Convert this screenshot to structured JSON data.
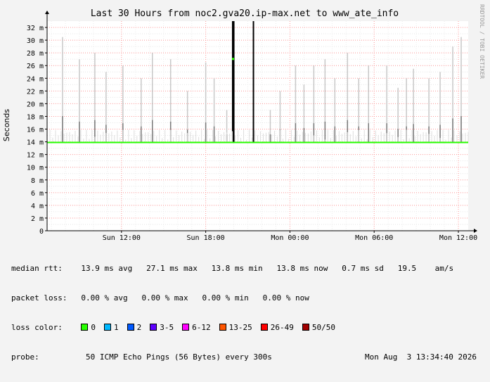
{
  "chart_data": {
    "type": "line",
    "title": "Last 30 Hours from noc2.gva20.ip-max.net to www_ate_info",
    "ylabel": "Seconds",
    "watermark": "RRDTOOL / TOBI OETIKER",
    "ylim": [
      0,
      33
    ],
    "y_ticks": [
      {
        "v": 0,
        "label": "0"
      },
      {
        "v": 2,
        "label": "2 m"
      },
      {
        "v": 4,
        "label": "4 m"
      },
      {
        "v": 6,
        "label": "6 m"
      },
      {
        "v": 8,
        "label": "8 m"
      },
      {
        "v": 10,
        "label": "10 m"
      },
      {
        "v": 12,
        "label": "12 m"
      },
      {
        "v": 14,
        "label": "14 m"
      },
      {
        "v": 16,
        "label": "16 m"
      },
      {
        "v": 18,
        "label": "18 m"
      },
      {
        "v": 20,
        "label": "20 m"
      },
      {
        "v": 22,
        "label": "22 m"
      },
      {
        "v": 24,
        "label": "24 m"
      },
      {
        "v": 26,
        "label": "26 m"
      },
      {
        "v": 28,
        "label": "28 m"
      },
      {
        "v": 30,
        "label": "30 m"
      },
      {
        "v": 32,
        "label": "32 m"
      }
    ],
    "xlim_hours": [
      0,
      30
    ],
    "x_ticks": [
      {
        "h": 5.3,
        "label": "Sun 12:00"
      },
      {
        "h": 11.3,
        "label": "Sun 18:00"
      },
      {
        "h": 17.3,
        "label": "Mon 00:00"
      },
      {
        "h": 23.3,
        "label": "Mon 06:00"
      },
      {
        "h": 29.3,
        "label": "Mon 12:00"
      }
    ],
    "median_rtt_ms": 13.9,
    "spikes": [
      {
        "h": 13.22,
        "top": 33,
        "dark": true
      },
      {
        "h": 13.3,
        "top": 33,
        "dark": true
      },
      {
        "h": 14.7,
        "top": 33,
        "dark": true
      },
      {
        "h": 1.1,
        "top": 30.5
      },
      {
        "h": 2.3,
        "top": 27
      },
      {
        "h": 3.4,
        "top": 28
      },
      {
        "h": 4.2,
        "top": 25
      },
      {
        "h": 5.4,
        "top": 26
      },
      {
        "h": 6.7,
        "top": 24
      },
      {
        "h": 7.5,
        "top": 28
      },
      {
        "h": 8.8,
        "top": 27
      },
      {
        "h": 10.0,
        "top": 22
      },
      {
        "h": 11.3,
        "top": 26.5
      },
      {
        "h": 11.9,
        "top": 24
      },
      {
        "h": 12.8,
        "top": 19
      },
      {
        "h": 15.9,
        "top": 19
      },
      {
        "h": 16.6,
        "top": 22
      },
      {
        "h": 17.7,
        "top": 26
      },
      {
        "h": 18.3,
        "top": 23
      },
      {
        "h": 19.0,
        "top": 26
      },
      {
        "h": 19.8,
        "top": 27
      },
      {
        "h": 20.5,
        "top": 24
      },
      {
        "h": 21.4,
        "top": 28
      },
      {
        "h": 22.2,
        "top": 24
      },
      {
        "h": 22.9,
        "top": 26
      },
      {
        "h": 24.2,
        "top": 26
      },
      {
        "h": 25.0,
        "top": 22.5
      },
      {
        "h": 25.6,
        "top": 24
      },
      {
        "h": 26.1,
        "top": 25.5
      },
      {
        "h": 27.2,
        "top": 24
      },
      {
        "h": 28.0,
        "top": 25
      },
      {
        "h": 28.9,
        "top": 29
      },
      {
        "h": 29.5,
        "top": 30.5
      }
    ],
    "green_marks": [
      {
        "h": 13.22,
        "v": 27.1
      }
    ]
  },
  "legend": {
    "median_label": "median rtt:",
    "median_values": "13.9 ms avg   27.1 ms max   13.8 ms min   13.8 ms now   0.7 ms sd   19.5    am/s",
    "loss_label": "packet loss:",
    "loss_values": "0.00 % avg   0.00 % max   0.00 % min   0.00 % now",
    "color_label": "loss color:",
    "colors": [
      {
        "label": "0",
        "color": "#26ff00"
      },
      {
        "label": "1",
        "color": "#00b8ff"
      },
      {
        "label": "2",
        "color": "#0059ff"
      },
      {
        "label": "3-5",
        "color": "#5e00ff"
      },
      {
        "label": "6-12",
        "color": "#ff00ff"
      },
      {
        "label": "13-25",
        "color": "#ff5500"
      },
      {
        "label": "26-49",
        "color": "#ff0000"
      },
      {
        "label": "50/50",
        "color": "#a10000"
      }
    ],
    "probe_label": "probe:",
    "probe_text": "50 ICMP Echo Pings (56 Bytes) every 300s",
    "timestamp": "Mon Aug  3 13:34:40 2026"
  },
  "colors": {
    "background": "#f3f3f3",
    "plot": "#ffffff",
    "grid": "#ff9999",
    "median": "#26ff00",
    "spike_light": "#c8c8c8",
    "spike_dark": "#000000"
  }
}
